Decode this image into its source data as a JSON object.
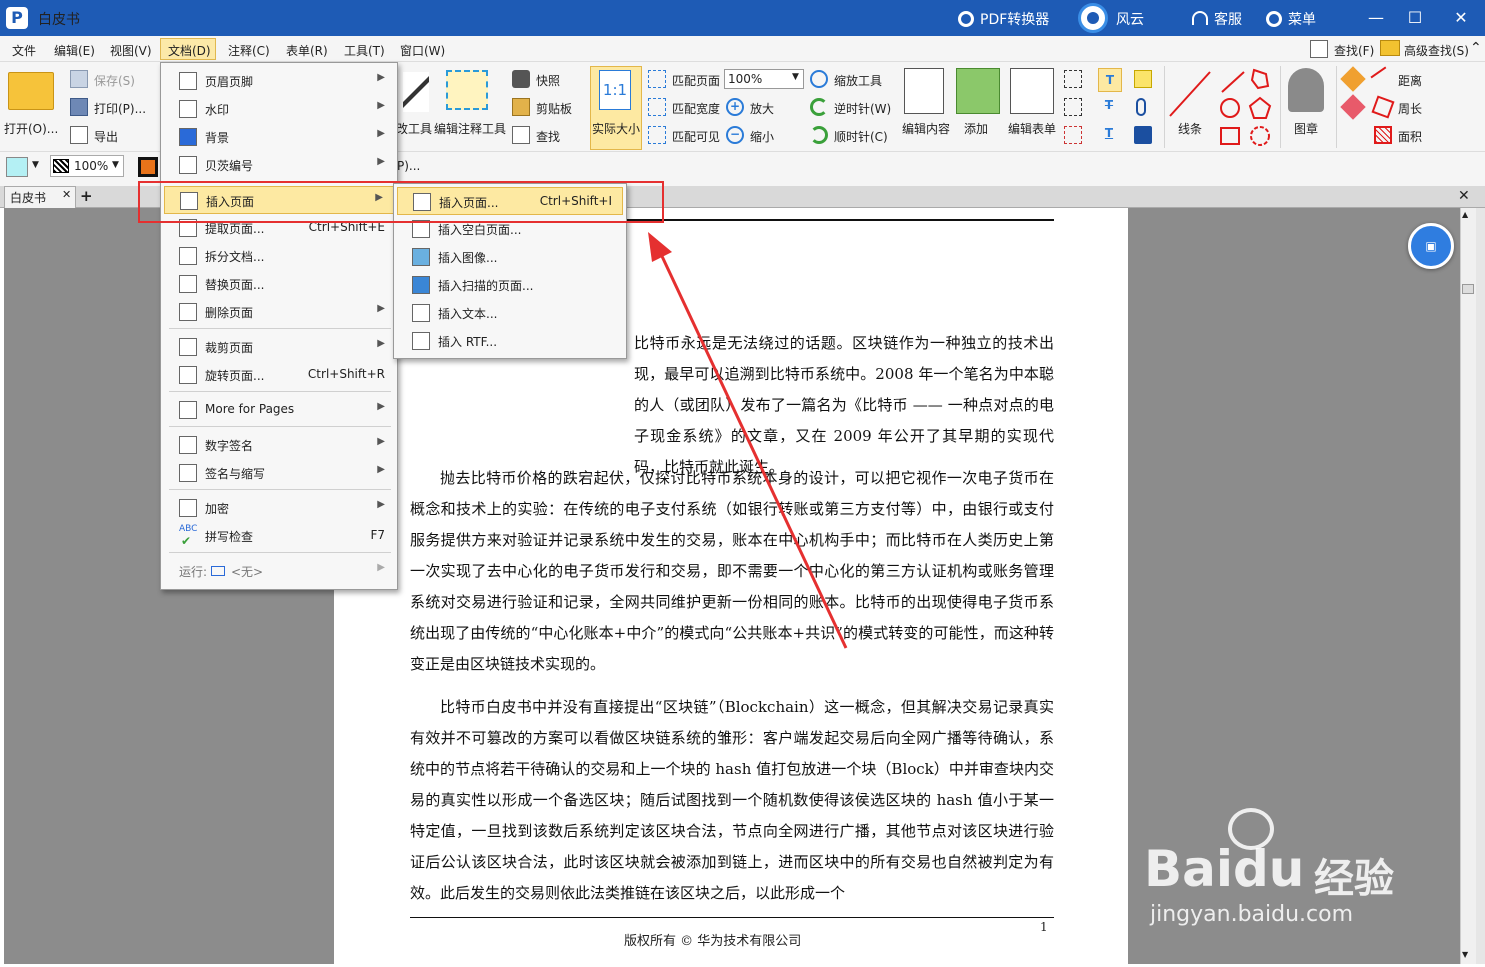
{
  "app": {
    "title": "白皮书",
    "pdf_converter": "PDF转换器",
    "fengyun": "风云",
    "service": "客服",
    "menu": "菜单"
  },
  "menubar": {
    "items": [
      "文件",
      "编辑(E)",
      "视图(V)",
      "文档(D)",
      "注释(C)",
      "表单(R)",
      "工具(T)",
      "窗口(W)"
    ],
    "find": "查找(F)",
    "adv_find": "高级查找(S)"
  },
  "ribbon": {
    "open": "打开(O)...",
    "save": "保存(S)",
    "print": "打印(P)...",
    "export": "导出",
    "snapshot": "快照",
    "clipboard": "剪贴板",
    "find": "查找",
    "actual_size": "实际大小",
    "actual_icon": "1:1",
    "fit_page": "匹配页面",
    "fit_width": "匹配宽度",
    "fit_visible": "匹配可见",
    "zoom_value": "100%",
    "zoom_tool": "缩放工具",
    "zoom_in": "放大",
    "zoom_out": "缩小",
    "ccw": "逆时针(W)",
    "cw": "顺时针(C)",
    "edit_content": "编辑内容",
    "add": "添加",
    "edit_form": "编辑表单",
    "edit_tool": "改工具",
    "edit_annot_tool": "编辑注释工具",
    "lines": "线条",
    "stamp": "图章",
    "distance": "距离",
    "perimeter": "周长",
    "area": "面积"
  },
  "toolbar2": {
    "opacity": "100%",
    "p_trail": "P)..."
  },
  "tab": {
    "label": "白皮书"
  },
  "doc_menu": {
    "header_footer": "页眉页脚",
    "watermark": "水印",
    "background": "背景",
    "bates": "贝茨编号",
    "insert_pages": "插入页面",
    "extract_pages": "提取页面...",
    "extract_sc": "Ctrl+Shift+E",
    "split": "拆分文档...",
    "replace": "替换页面...",
    "delete": "删除页面",
    "crop": "裁剪页面",
    "rotate": "旋转页面...",
    "rotate_sc": "Ctrl+Shift+R",
    "more_pages": "More for Pages",
    "digital_sig": "数字签名",
    "sign_initial": "签名与缩写",
    "encrypt": "加密",
    "spell": "拼写检查",
    "spell_sc": "F7",
    "spell_abc": "ABC",
    "run": "运行:",
    "run_value": "<无>"
  },
  "insert_menu": {
    "insert_page": "插入页面...",
    "insert_page_sc": "Ctrl+Shift+I",
    "insert_blank": "插入空白页面...",
    "insert_image": "插入图像...",
    "insert_scan": "插入扫描的页面...",
    "insert_text": "插入文本...",
    "insert_rtf": "插入 RTF..."
  },
  "document": {
    "p1": "比特币永远是无法绕过的话题。区块链作为一种独立的技术出现，最早可以追溯到比特币系统中。2008 年一个笔名为中本聪的人（或团队）发布了一篇名为《比特币 —— 一种点对点的电子现金系统》的文章，又在 2009 年公开了其早期的实现代码，比特币就此诞生。",
    "p2": "抛去比特币价格的跌宕起伏，仅探讨比特币系统本身的设计，可以把它视作一次电子货币在概念和技术上的实验：在传统的电子支付系统（如银行转账或第三方支付等）中，由银行或支付服务提供方来对验证并记录系统中发生的交易，账本在中心机构手中；而比特币在人类历史上第一次实现了去中心化的电子货币发行和交易，即不需要一个中心化的第三方认证机构或账务管理系统对交易进行验证和记录，全网共同维护更新一份相同的账本。比特币的出现使得电子货币系统出现了由传统的“中心化账本+中介”的模式向“公共账本+共识”的模式转变的可能性，而这种转变正是由区块链技术实现的。",
    "p3": "比特币白皮书中并没有直接提出“区块链”（Blockchain）这一概念，但其解决交易记录真实有效并不可篡改的方案可以看做区块链系统的雏形：客户端发起交易后向全网广播等待确认，系统中的节点将若干待确认的交易和上一个块的 hash 值打包放进一个块（Block）中并审查块内交易的真实性以形成一个备选区块；随后试图找到一个随机数使得该侯选区块的 hash 值小于某一特定值，一旦找到该数后系统判定该区块合法，节点向全网进行广播，其他节点对该区块进行验证后公认该区块合法，此时该区块就会被添加到链上，进而区块中的所有交易也自然被判定为有效。此后发生的交易则依此法类推链在该区块之后，以此形成一个",
    "page_number": "1",
    "footer": "版权所有 © 华为技术有限公司"
  },
  "watermark": {
    "brand": "Bai",
    "brand2": "du",
    "cn": "经验",
    "url": "jingyan.baidu.com"
  },
  "colors": {
    "title_bg": "#1e5bb5",
    "highlight": "#fde9a2",
    "annotation": "#e53030",
    "swatch": "#b4f0f4"
  }
}
